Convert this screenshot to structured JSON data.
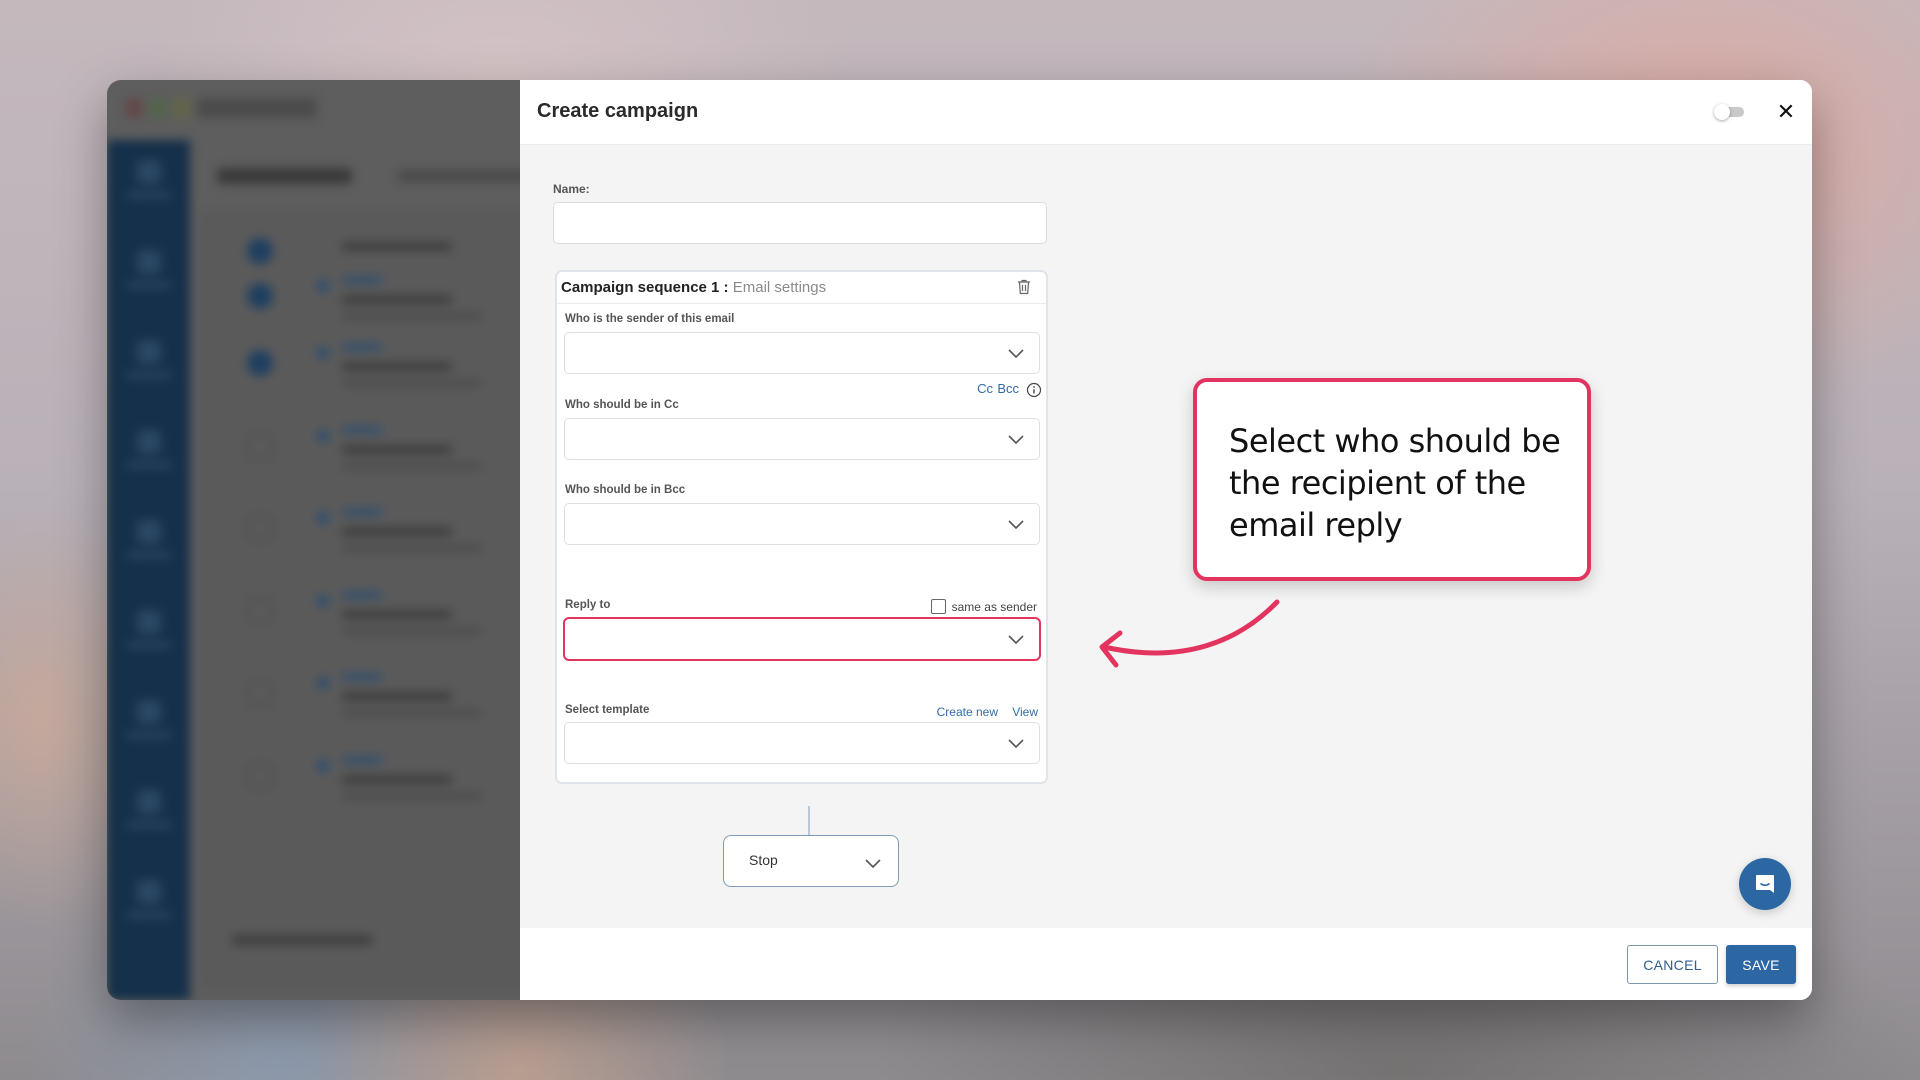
{
  "modal": {
    "title": "Create campaign",
    "toggle_on": false,
    "close_icon": "close-icon",
    "name_label": "Name:",
    "name_value": "",
    "sequence": {
      "title": "Campaign sequence 1 :",
      "subtitle": "Email settings",
      "sender_label": "Who is the sender of this email",
      "sender_value": "",
      "cc_link": "Cc",
      "bcc_link": "Bcc",
      "cc_label": "Who should be in Cc",
      "cc_value": "",
      "bcc_label": "Who should be in Bcc",
      "bcc_value": "",
      "reply_to_label": "Reply to",
      "same_as_sender_label": "same as sender",
      "same_as_sender_checked": false,
      "reply_to_value": "",
      "template_label": "Select template",
      "create_new_link": "Create new",
      "view_link": "View",
      "template_value": ""
    },
    "next_step": {
      "value": "Stop"
    },
    "footer": {
      "cancel_label": "CANCEL",
      "save_label": "SAVE"
    }
  },
  "annotation": {
    "text": "Select who should be the recipient of the email reply",
    "color": "#e3345f"
  },
  "colors": {
    "primary": "#2c66a3",
    "link": "#2f6da9",
    "highlight": "#e3345f",
    "sidebar_bg": "#15304a"
  }
}
